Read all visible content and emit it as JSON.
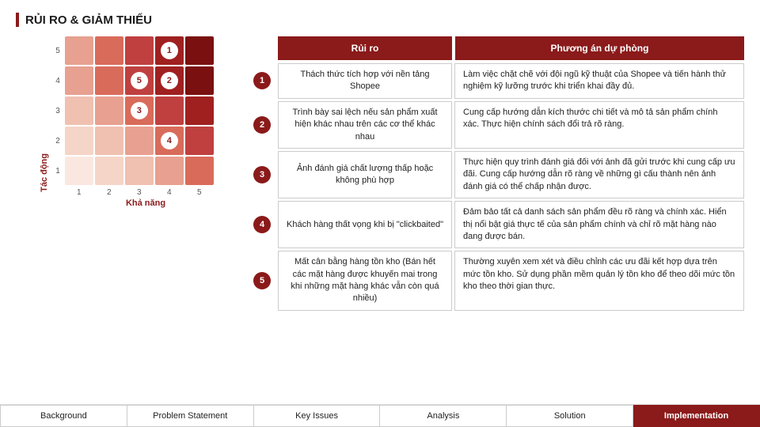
{
  "title": "RỦI RO & GIẢM THIỂU",
  "matrix": {
    "y_label": "Tác động",
    "x_label": "Khả năng",
    "y_ticks": [
      "5",
      "4",
      "3",
      "2",
      "1"
    ],
    "x_ticks": [
      "1",
      "2",
      "3",
      "4",
      "5"
    ],
    "cells": [
      {
        "row": 0,
        "col": 0,
        "color": "#e8a090",
        "label": null
      },
      {
        "row": 0,
        "col": 1,
        "color": "#d96b5a",
        "label": null
      },
      {
        "row": 0,
        "col": 2,
        "color": "#c04040",
        "label": null
      },
      {
        "row": 0,
        "col": 3,
        "color": "#a02020",
        "label": "1"
      },
      {
        "row": 0,
        "col": 4,
        "color": "#7a1010",
        "label": null
      },
      {
        "row": 1,
        "col": 0,
        "color": "#e8a090",
        "label": null
      },
      {
        "row": 1,
        "col": 1,
        "color": "#d96b5a",
        "label": null
      },
      {
        "row": 1,
        "col": 2,
        "color": "#c04040",
        "label": "5"
      },
      {
        "row": 1,
        "col": 3,
        "color": "#a02020",
        "label": "2"
      },
      {
        "row": 1,
        "col": 4,
        "color": "#7a1010",
        "label": null
      },
      {
        "row": 2,
        "col": 0,
        "color": "#f0c0b0",
        "label": null
      },
      {
        "row": 2,
        "col": 1,
        "color": "#e8a090",
        "label": null
      },
      {
        "row": 2,
        "col": 2,
        "color": "#d96b5a",
        "label": "3"
      },
      {
        "row": 2,
        "col": 3,
        "color": "#c04040",
        "label": null
      },
      {
        "row": 2,
        "col": 4,
        "color": "#a02020",
        "label": null
      },
      {
        "row": 3,
        "col": 0,
        "color": "#f5d5c8",
        "label": null
      },
      {
        "row": 3,
        "col": 1,
        "color": "#f0c0b0",
        "label": null
      },
      {
        "row": 3,
        "col": 2,
        "color": "#e8a090",
        "label": null
      },
      {
        "row": 3,
        "col": 3,
        "color": "#d96b5a",
        "label": "4"
      },
      {
        "row": 3,
        "col": 4,
        "color": "#c04040",
        "label": null
      },
      {
        "row": 4,
        "col": 0,
        "color": "#fae8e0",
        "label": null
      },
      {
        "row": 4,
        "col": 1,
        "color": "#f5d5c8",
        "label": null
      },
      {
        "row": 4,
        "col": 2,
        "color": "#f0c0b0",
        "label": null
      },
      {
        "row": 4,
        "col": 3,
        "color": "#e8a090",
        "label": null
      },
      {
        "row": 4,
        "col": 4,
        "color": "#d96b5a",
        "label": null
      }
    ]
  },
  "table": {
    "col1_header": "Rủi ro",
    "col2_header": "Phương án dự phòng",
    "rows": [
      {
        "number": "1",
        "risk": "Thách thức tích hợp với nền tảng Shopee",
        "solution": "Làm việc chặt chẽ với đội ngũ kỹ thuật của Shopee và tiến hành thử nghiệm kỹ lưỡng trước khi triển khai đầy đủ."
      },
      {
        "number": "2",
        "risk": "Trình bày sai lệch nếu sản phẩm xuất hiện khác nhau trên các cơ thể khác nhau",
        "solution": "Cung cấp hướng dẫn kích thước chi tiết và mô tả sản phẩm chính xác. Thực hiện chính sách đổi trả rõ ràng."
      },
      {
        "number": "3",
        "risk": "Ảnh đánh giá chất lượng thấp hoặc không phù hợp",
        "solution": "Thực hiện quy trình đánh giá đối với ảnh đã gửi trước khi cung cấp ưu đãi. Cung cấp hướng dẫn rõ ràng về những gì cấu thành nên ảnh đánh giá có thể chấp nhận được."
      },
      {
        "number": "4",
        "risk": "Khách hàng thất vọng khi bị \"clickbaited\"",
        "solution": "Đảm bảo tất cả danh sách sản phẩm đều rõ ràng và chính xác. Hiển thị nổi bật giá thực tế của sản phẩm chính và chỉ rõ mặt hàng nào đang được bán."
      },
      {
        "number": "5",
        "risk": "Mất cân bằng hàng tồn kho (Bán hết các mặt hàng được khuyến mai trong khi những mặt hàng khác vẫn còn quá nhiều)",
        "solution": "Thường xuyên xem xét và điều chỉnh các ưu đãi kết hợp dựa trên mức tồn kho. Sử dụng phần mềm quản lý tồn kho để theo dõi mức tồn kho theo thời gian thực."
      }
    ]
  },
  "footer": {
    "buttons": [
      {
        "label": "Background",
        "active": false
      },
      {
        "label": "Problem Statement",
        "active": false
      },
      {
        "label": "Key Issues",
        "active": false
      },
      {
        "label": "Analysis",
        "active": false
      },
      {
        "label": "Solution",
        "active": false
      },
      {
        "label": "Implementation",
        "active": true
      }
    ]
  }
}
